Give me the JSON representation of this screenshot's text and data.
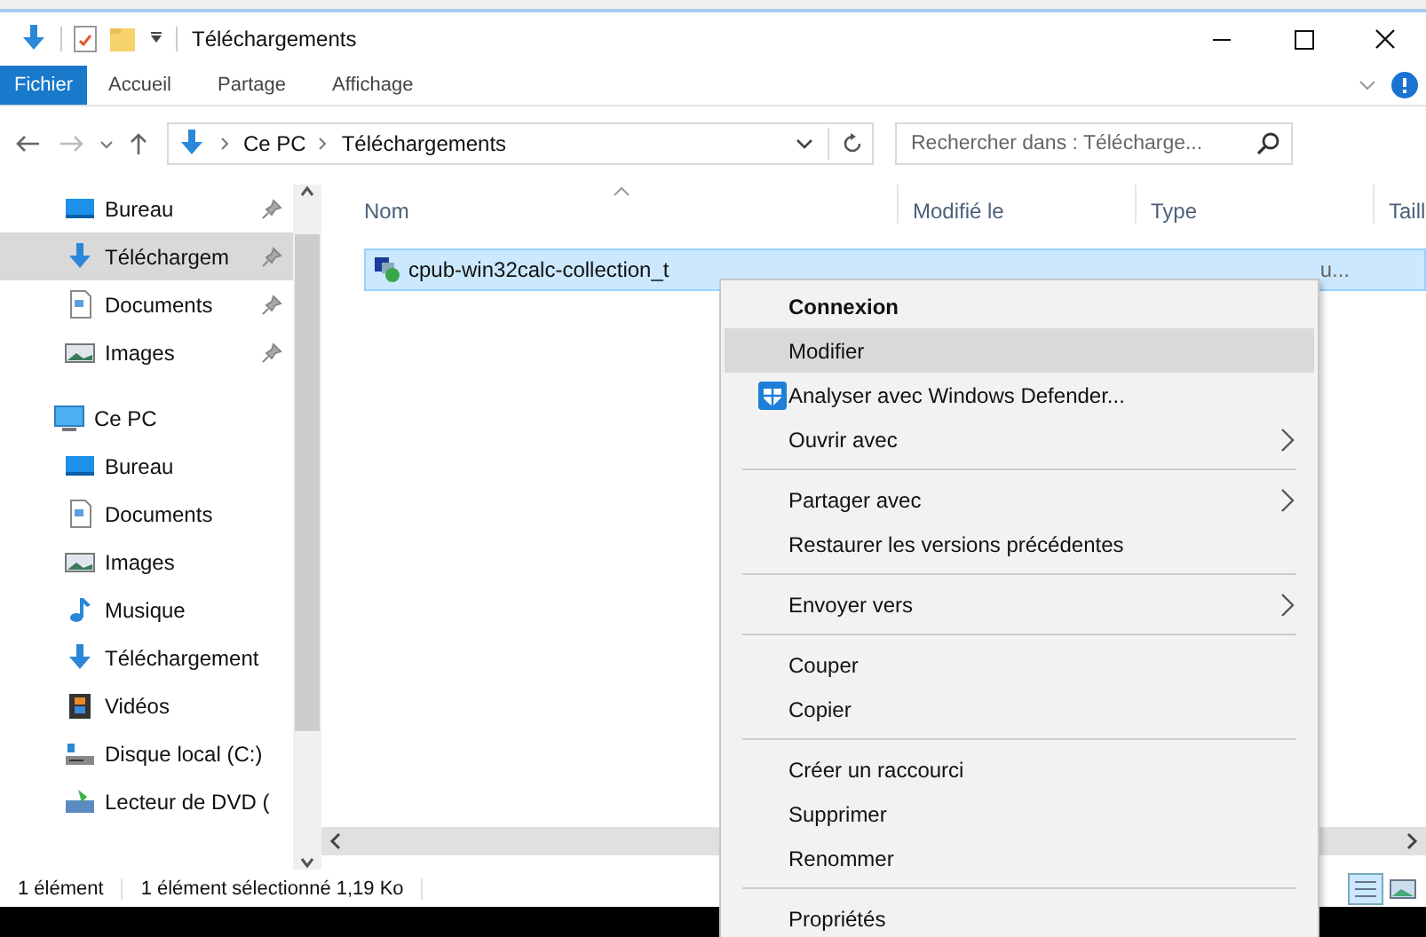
{
  "window": {
    "title": "Téléchargements"
  },
  "ribbon": {
    "tabs": [
      {
        "label": "Fichier",
        "selected": true
      },
      {
        "label": "Accueil",
        "selected": false
      },
      {
        "label": "Partage",
        "selected": false
      },
      {
        "label": "Affichage",
        "selected": false
      }
    ]
  },
  "address": {
    "path": [
      "Ce PC",
      "Téléchargements"
    ]
  },
  "search": {
    "placeholder": "Rechercher dans : Télécharge..."
  },
  "sidebar": {
    "quick_access": [
      {
        "label": "Bureau",
        "kind": "desktop",
        "pinned": true,
        "selected": false
      },
      {
        "label": "Téléchargem",
        "kind": "download",
        "pinned": true,
        "selected": true
      },
      {
        "label": "Documents",
        "kind": "document",
        "pinned": true,
        "selected": false
      },
      {
        "label": "Images",
        "kind": "image",
        "pinned": true,
        "selected": false
      }
    ],
    "groups": [
      {
        "label": "Ce PC",
        "kind": "pc",
        "selected": false,
        "children": [
          {
            "label": "Bureau",
            "kind": "desktop",
            "selected": false
          },
          {
            "label": "Documents",
            "kind": "document",
            "selected": false
          },
          {
            "label": "Images",
            "kind": "image",
            "selected": false
          },
          {
            "label": "Musique",
            "kind": "music",
            "selected": false
          },
          {
            "label": "Téléchargement",
            "kind": "download",
            "selected": false
          },
          {
            "label": "Vidéos",
            "kind": "video",
            "selected": false
          },
          {
            "label": "Disque local (C:)",
            "kind": "drive",
            "selected": false
          },
          {
            "label": "Lecteur de DVD (",
            "kind": "dvd",
            "selected": false
          }
        ]
      }
    ]
  },
  "table": {
    "columns": [
      "Nom",
      "Modifié le",
      "Type",
      "Taill"
    ],
    "rows": [
      {
        "name": "cpub-win32calc-collection_t",
        "type": "u...",
        "selected": true
      }
    ]
  },
  "context_menu": {
    "items": [
      {
        "kind": "item",
        "label": "Connexion",
        "default": true,
        "highlighted": false,
        "submenu": false
      },
      {
        "kind": "item",
        "label": "Modifier",
        "default": false,
        "highlighted": true,
        "submenu": false
      },
      {
        "kind": "item",
        "label": "Analyser avec Windows Defender...",
        "has_icon": true,
        "default": false,
        "highlighted": false,
        "submenu": false
      },
      {
        "kind": "item",
        "label": "Ouvrir avec",
        "default": false,
        "highlighted": false,
        "submenu": true
      },
      {
        "kind": "separator"
      },
      {
        "kind": "item",
        "label": "Partager avec",
        "default": false,
        "highlighted": false,
        "submenu": true
      },
      {
        "kind": "item",
        "label": "Restaurer les versions précédentes",
        "default": false,
        "highlighted": false,
        "submenu": false
      },
      {
        "kind": "separator"
      },
      {
        "kind": "item",
        "label": "Envoyer vers",
        "default": false,
        "highlighted": false,
        "submenu": true
      },
      {
        "kind": "separator"
      },
      {
        "kind": "item",
        "label": "Couper",
        "default": false,
        "highlighted": false,
        "submenu": false
      },
      {
        "kind": "item",
        "label": "Copier",
        "default": false,
        "highlighted": false,
        "submenu": false
      },
      {
        "kind": "separator"
      },
      {
        "kind": "item",
        "label": "Créer un raccourci",
        "default": false,
        "highlighted": false,
        "submenu": false
      },
      {
        "kind": "item",
        "label": "Supprimer",
        "default": false,
        "highlighted": false,
        "submenu": false
      },
      {
        "kind": "item",
        "label": "Renommer",
        "default": false,
        "highlighted": false,
        "submenu": false
      },
      {
        "kind": "separator"
      },
      {
        "kind": "item",
        "label": "Propriétés",
        "default": false,
        "highlighted": false,
        "submenu": false
      }
    ]
  },
  "status_bar": {
    "count": "1 élément",
    "selection": "1 élément sélectionné  1,19 Ko"
  }
}
